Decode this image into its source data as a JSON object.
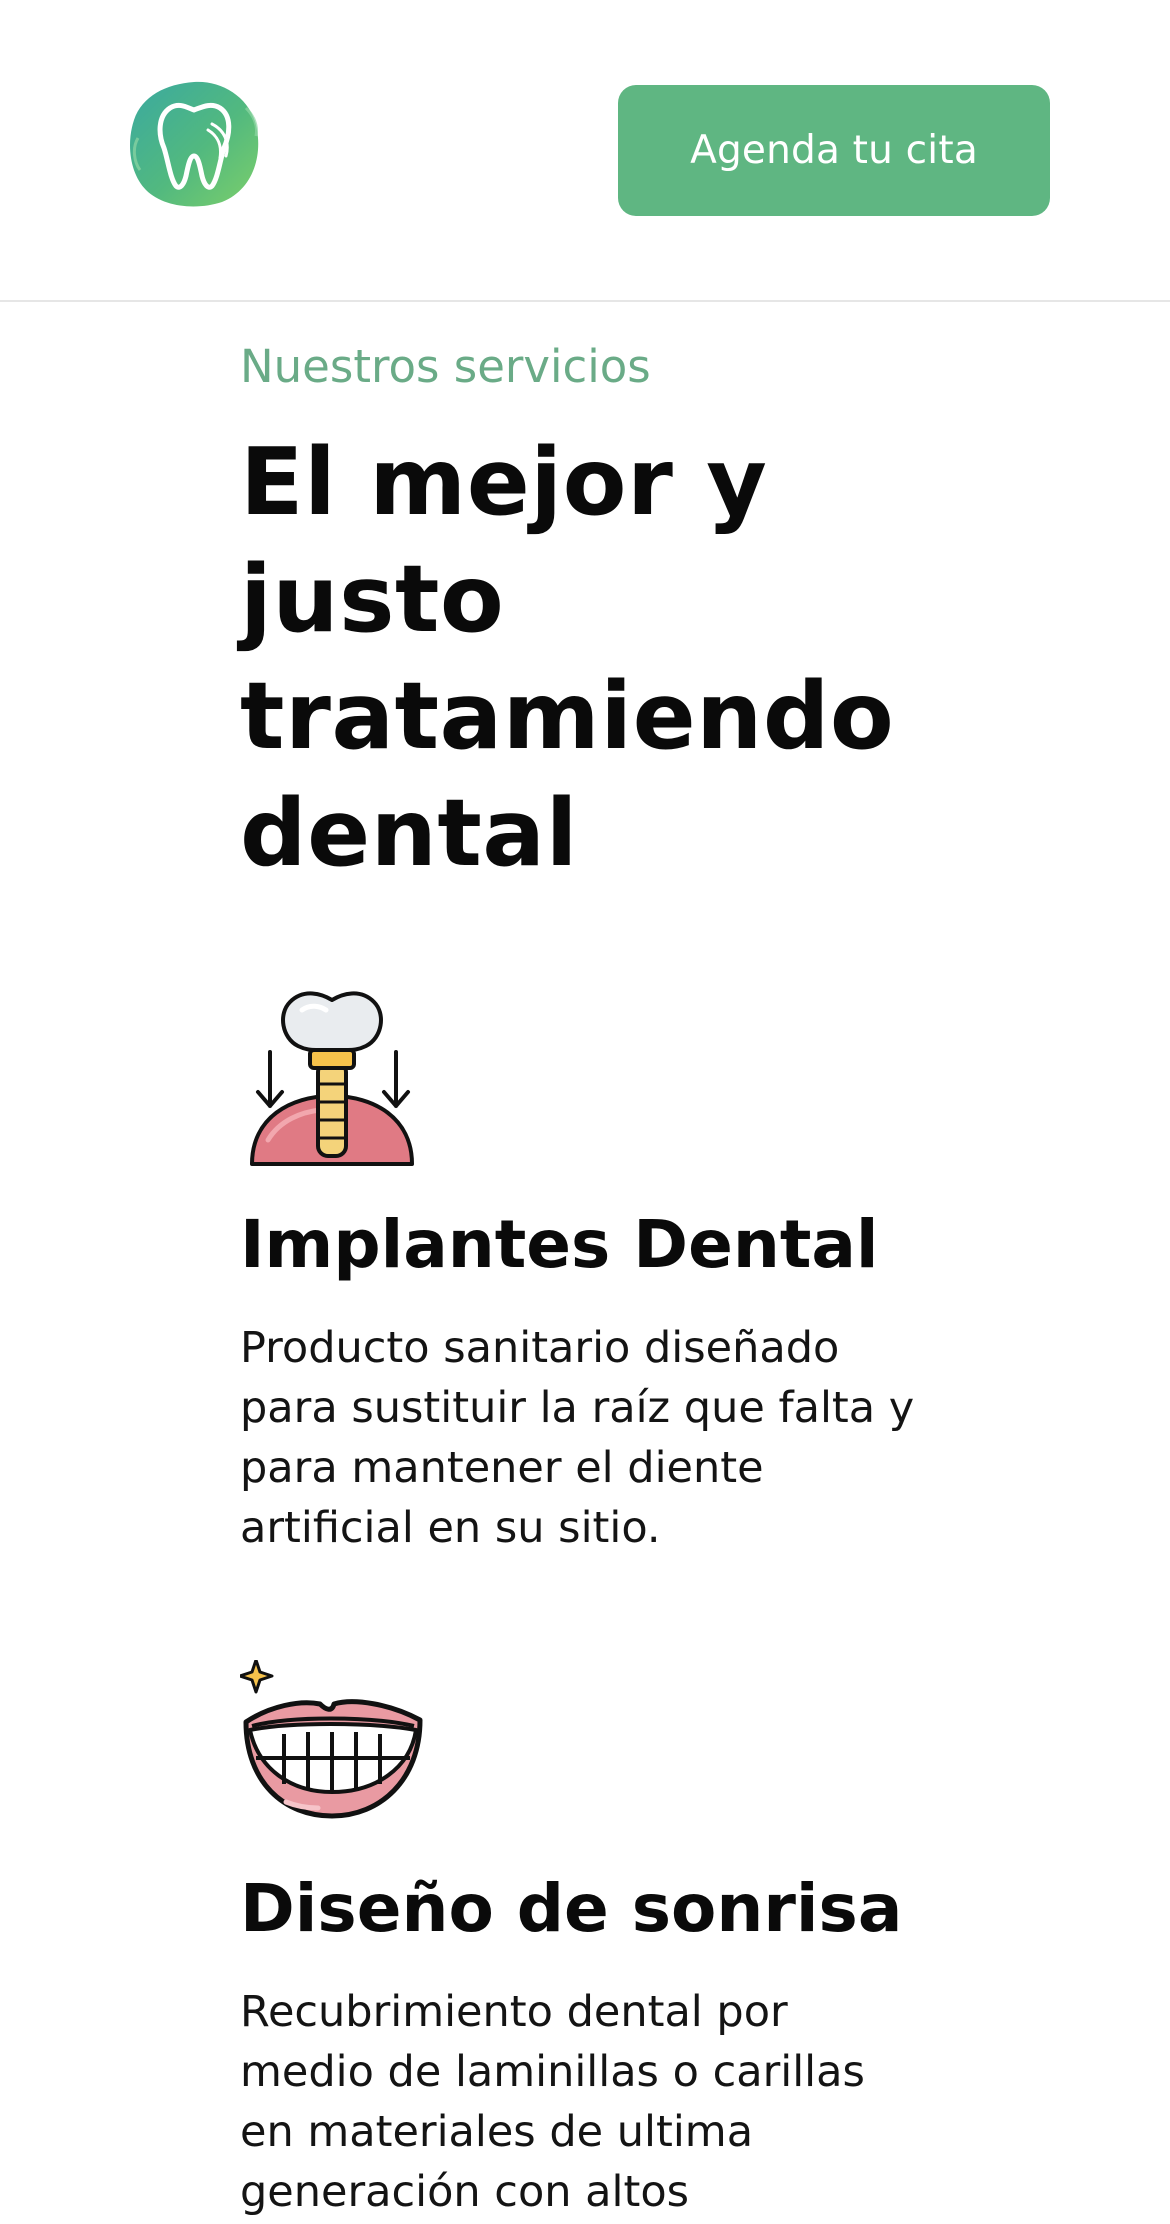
{
  "header": {
    "cta_label": "Agenda tu cita",
    "logo_icon": "tooth-logo-icon",
    "accent_color": "#5fb682"
  },
  "hero": {
    "eyebrow": "Nuestros servicios",
    "title_lines": [
      "El mejor y",
      "justo",
      "tratamiendo",
      "dental"
    ]
  },
  "services": [
    {
      "icon": "dental-implant-icon",
      "title": "Implantes Dental",
      "description": "Producto sanitario diseñado para sustituir la raíz que falta y para mantener el diente artificial en su sitio."
    },
    {
      "icon": "smile-design-icon",
      "title": "Diseño de sonrisa",
      "description": "Recubrimiento dental por medio de laminillas o carillas en materiales de ultima generación con altos"
    }
  ]
}
